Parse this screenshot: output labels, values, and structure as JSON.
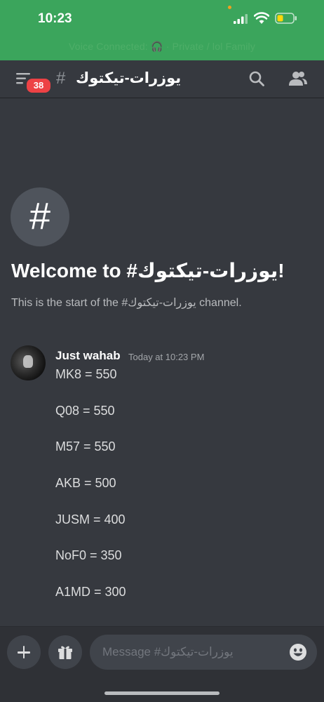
{
  "status": {
    "time": "10:23",
    "voice_bar": "Voice Connected: 🎧 · Private / lol Family"
  },
  "header": {
    "unread_badge": "38",
    "hash": "#",
    "channel_name": "يوزرات-تيكتوك",
    "icons": [
      "hamburger-menu-icon",
      "search-icon",
      "members-icon"
    ]
  },
  "welcome": {
    "icon_glyph": "#",
    "title": "Welcome to #يوزرات-تيكتوك!",
    "subtitle": "This is the start of the #يوزرات-تيكتوك channel."
  },
  "message": {
    "author": "Just wahab",
    "timestamp": "Today at 10:23 PM",
    "lines": [
      "MK8 = 550",
      "Q08 = 550",
      "M57 = 550",
      "AKB = 500",
      "JUSM = 400",
      "NoF0 = 350",
      "A1MD = 300"
    ]
  },
  "composer": {
    "placeholder": "Message #يوزرات-تيكتوك",
    "icons": [
      "plus-icon",
      "gift-icon",
      "emoji-icon"
    ]
  },
  "colors": {
    "background": "#36393f",
    "status_bar": "#3ba55c",
    "composer_bg": "#2f3136",
    "badge": "#ed4245"
  }
}
